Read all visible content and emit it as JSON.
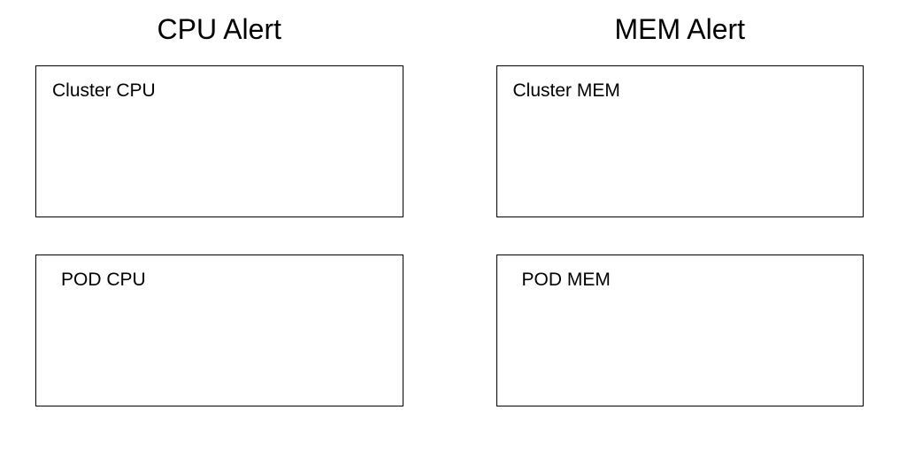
{
  "columns": [
    {
      "title": "CPU Alert",
      "boxes": [
        {
          "label": "Cluster CPU",
          "kind": "cluster"
        },
        {
          "label": "POD CPU",
          "kind": "pod"
        }
      ]
    },
    {
      "title": "MEM Alert",
      "boxes": [
        {
          "label": "Cluster MEM",
          "kind": "cluster"
        },
        {
          "label": "POD MEM",
          "kind": "pod"
        }
      ]
    }
  ]
}
